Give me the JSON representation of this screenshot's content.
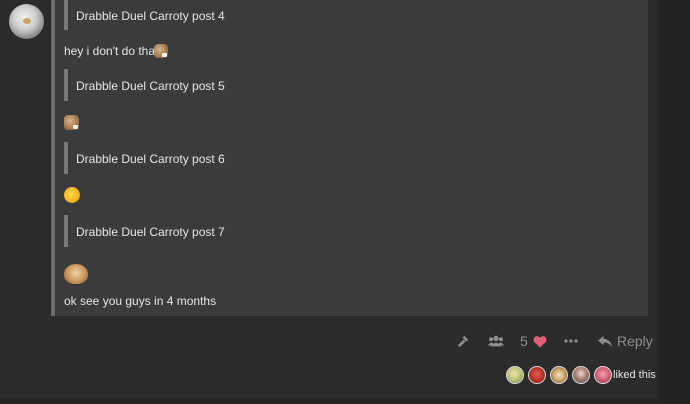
{
  "post": {
    "quotes": [
      {
        "text": "Drabble Duel Carroty post 4"
      },
      {
        "text": "Drabble Duel Carroty post 5"
      },
      {
        "text": "Drabble Duel Carroty post 6"
      },
      {
        "text": "Drabble Duel Carroty post 7"
      }
    ],
    "lines": {
      "reply_4": "hey i don't do that",
      "final": "ok see you guys in 4 months"
    },
    "emojis": {
      "after_reply_4": "dog-emoji",
      "after_post_5": "dog-emoji",
      "after_post_6": "chick-emoji",
      "after_post_7": "hamster-emoji"
    }
  },
  "actions": {
    "like_count": "5",
    "reply_label": "Reply",
    "icons": [
      "hammer-icon",
      "users-icon",
      "heart-icon",
      "more-icon",
      "reply-arrow-icon"
    ],
    "heart_color": "#e45e7a"
  },
  "likes": {
    "label": "liked this",
    "avatars": [
      "liker-avatar-1",
      "liker-avatar-2",
      "liker-avatar-3",
      "liker-avatar-4",
      "liker-avatar-5"
    ]
  },
  "colors": {
    "page_bg": "#2b2b2b",
    "post_bg": "#3b3b3b",
    "quote_bar": "#777777",
    "muted_icon": "#8e8e8e",
    "text": "#e6e6e6"
  }
}
